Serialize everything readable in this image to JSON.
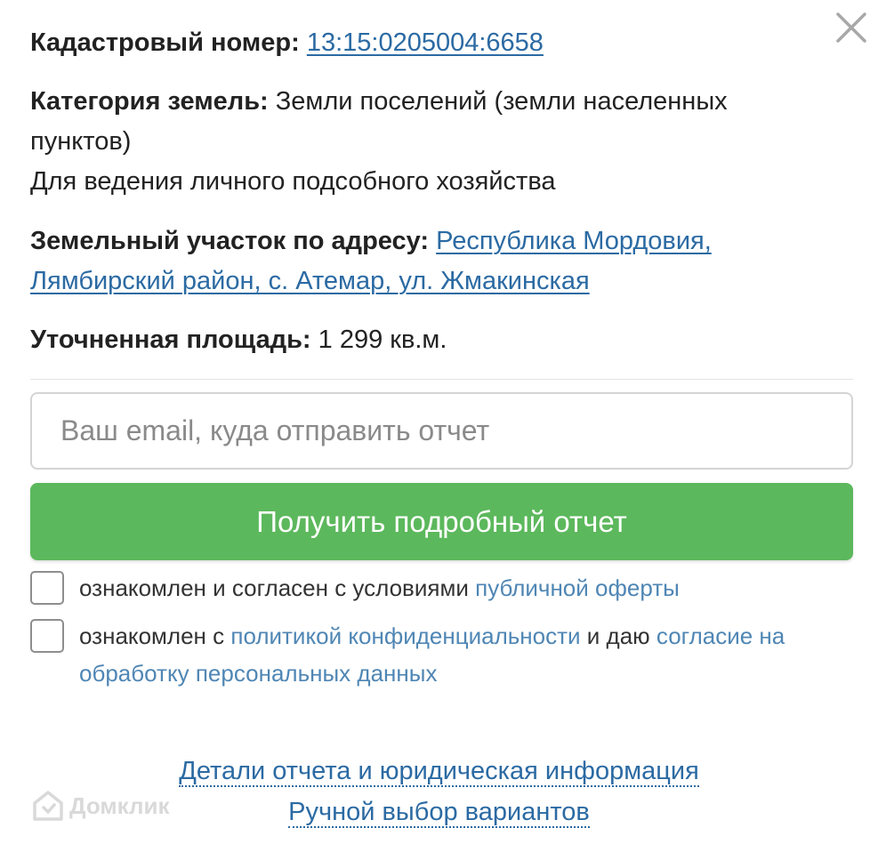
{
  "close": {
    "icon": "close-icon"
  },
  "property": {
    "cadastral_label": "Кадастровый номер:",
    "cadastral_number": "13:15:0205004:6658",
    "category_label": "Категория земель:",
    "category_value": "Земли поселений (земли населенных пунктов)",
    "usage": "Для ведения личного подсобного хозяйства",
    "address_label": "Земельный участок по адресу:",
    "address_value": "Республика Мордовия, Лямбирский район, с. Атемар, ул. Жмакинская",
    "area_label": "Уточненная площадь:",
    "area_value": "1 299 кв.м."
  },
  "form": {
    "email_placeholder": "Ваш email, куда отправить отчет",
    "email_value": "",
    "submit_label": "Получить подробный отчет"
  },
  "consents": {
    "offer_text": "ознакомлен и согласен с условиями",
    "offer_link": "публичной оферты",
    "privacy_text_1": "ознакомлен с",
    "privacy_link": "политикой конфиденциальности",
    "privacy_text_2": "и даю",
    "consent_link": "согласие на обработку персональных данных"
  },
  "footer": {
    "details_link": "Детали отчета и юридическая информация",
    "manual_link": "Ручной выбор вариантов"
  },
  "watermark": {
    "text": "Домклик",
    "icon": "domclick-logo-icon"
  },
  "colors": {
    "link": "#2b6aa3",
    "light_link": "#4f86b4",
    "button": "#5cb85c"
  }
}
